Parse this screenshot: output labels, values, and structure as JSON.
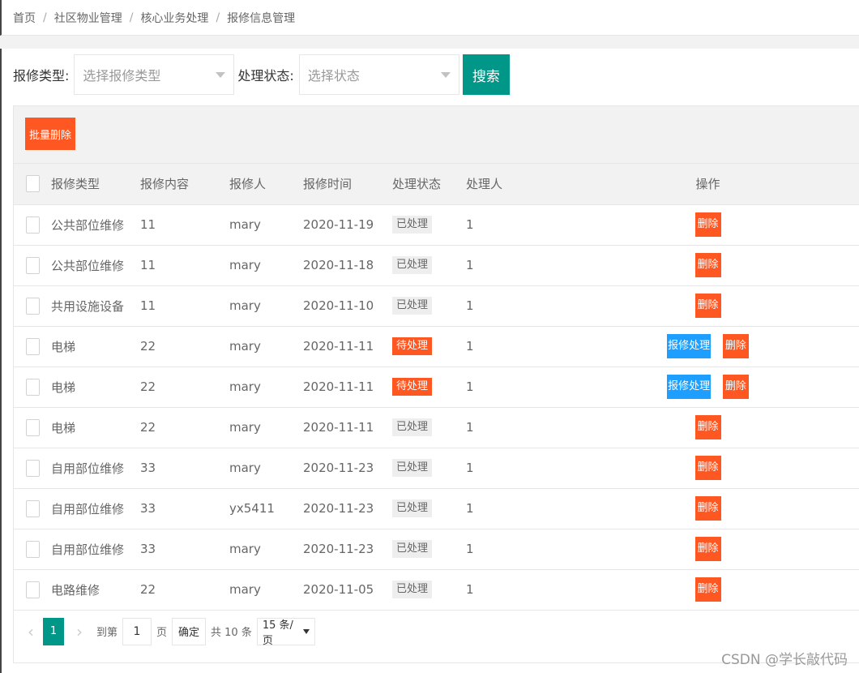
{
  "breadcrumb": [
    "首页",
    "社区物业管理",
    "核心业务处理",
    "报修信息管理"
  ],
  "filters": {
    "type_label": "报修类型:",
    "type_placeholder": "选择报修类型",
    "status_label": "处理状态:",
    "status_placeholder": "选择状态",
    "search_label": "搜索"
  },
  "toolbar": {
    "batch_delete_label": "批量删除"
  },
  "table": {
    "headers": [
      "报修类型",
      "报修内容",
      "报修人",
      "报修时间",
      "处理状态",
      "处理人",
      "操作"
    ],
    "rows": [
      {
        "type": "公共部位维修",
        "content": "11",
        "reporter": "mary",
        "date": "2020-11-19",
        "status": "已处理",
        "handler": "1"
      },
      {
        "type": "公共部位维修",
        "content": "11",
        "reporter": "mary",
        "date": "2020-11-18",
        "status": "已处理",
        "handler": "1"
      },
      {
        "type": "共用设施设备",
        "content": "11",
        "reporter": "mary",
        "date": "2020-11-10",
        "status": "已处理",
        "handler": "1"
      },
      {
        "type": "电梯",
        "content": "22",
        "reporter": "mary",
        "date": "2020-11-11",
        "status": "待处理",
        "handler": "1"
      },
      {
        "type": "电梯",
        "content": "22",
        "reporter": "mary",
        "date": "2020-11-11",
        "status": "待处理",
        "handler": "1"
      },
      {
        "type": "电梯",
        "content": "22",
        "reporter": "mary",
        "date": "2020-11-11",
        "status": "已处理",
        "handler": "1"
      },
      {
        "type": "自用部位维修",
        "content": "33",
        "reporter": "mary",
        "date": "2020-11-23",
        "status": "已处理",
        "handler": "1"
      },
      {
        "type": "自用部位维修",
        "content": "33",
        "reporter": "yx5411",
        "date": "2020-11-23",
        "status": "已处理",
        "handler": "1"
      },
      {
        "type": "自用部位维修",
        "content": "33",
        "reporter": "mary",
        "date": "2020-11-23",
        "status": "已处理",
        "handler": "1"
      },
      {
        "type": "电路维修",
        "content": "22",
        "reporter": "mary",
        "date": "2020-11-05",
        "status": "已处理",
        "handler": "1"
      }
    ],
    "pending_status": "待处理",
    "handle_label": "报修处理",
    "delete_label": "删除"
  },
  "pager": {
    "current_page": "1",
    "goto_label": "到第",
    "goto_value": "1",
    "page_unit": "页",
    "confirm_label": "确定",
    "total_label": "共 10 条",
    "page_size": "15 条/页"
  },
  "watermark": "CSDN @学长敲代码",
  "colors": {
    "primary": "#009688",
    "danger": "#ff5722",
    "info": "#1e9fff"
  }
}
